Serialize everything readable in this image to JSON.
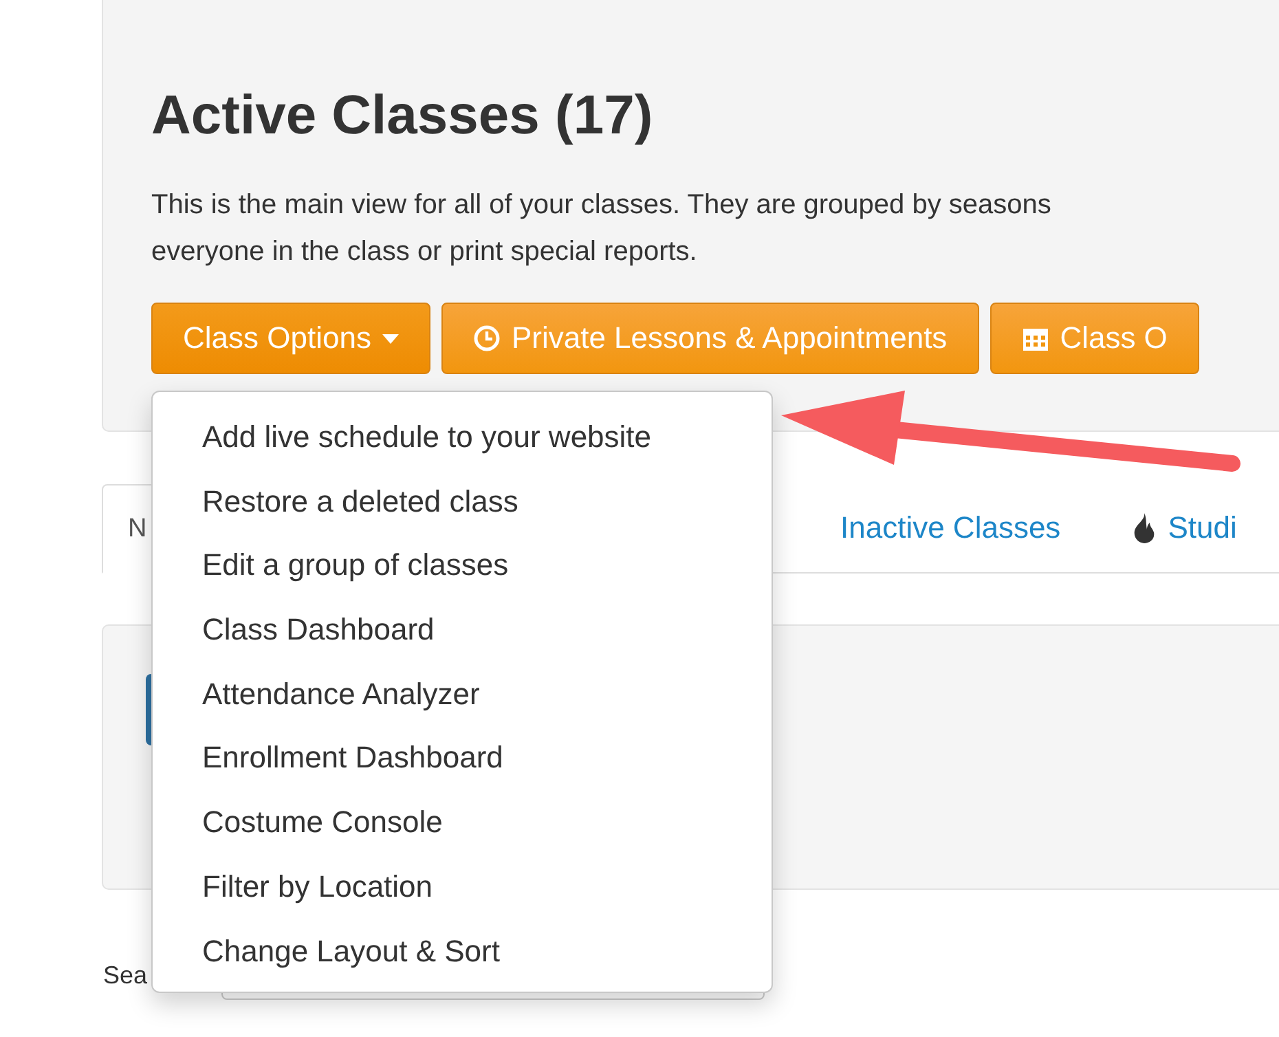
{
  "header": {
    "title": "Active Classes (17)",
    "description": [
      "This is the main view for all of your classes. They are grouped by seasons",
      "everyone in the class or print special reports."
    ]
  },
  "buttons": [
    {
      "label": "Class Options"
    },
    {
      "label": "Private Lessons & Appointments"
    },
    {
      "label": "Class O"
    }
  ],
  "dropdown": {
    "items": [
      "Add live schedule to your website",
      "Restore a deleted class",
      "Edit a group of classes",
      "Class Dashboard",
      "Attendance Analyzer",
      "Enrollment Dashboard",
      "Costume Console",
      "Filter by Location",
      "Change Layout & Sort"
    ]
  },
  "tabs": [
    {
      "label": "N",
      "selected": true
    },
    {
      "label": "Inactive Classes",
      "selected": false
    },
    {
      "label": "Studi",
      "selected": false
    }
  ],
  "search": {
    "label": "Sea"
  }
}
